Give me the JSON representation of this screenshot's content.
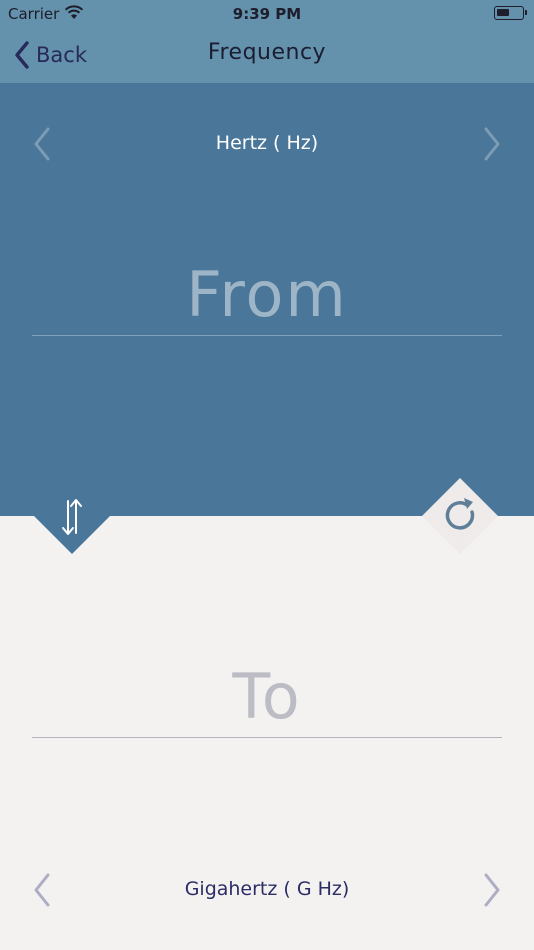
{
  "status_bar": {
    "carrier": "Carrier",
    "time": "9:39 PM"
  },
  "nav": {
    "back_label": "Back",
    "title": "Frequency"
  },
  "from": {
    "unit": "Hertz ( Hz)",
    "placeholder": "From"
  },
  "to": {
    "unit": "Gigahertz ( G Hz)",
    "placeholder": "To"
  },
  "icons": [
    "wifi-icon",
    "battery-icon",
    "chevron-left-icon",
    "chevron-right-icon",
    "swap-icon",
    "refresh-icon"
  ],
  "colors": {
    "top_panel": "#4a7799",
    "nav_bar": "#6491ab",
    "bottom_panel": "#f4f1f1",
    "accent": "#2b2e66"
  }
}
